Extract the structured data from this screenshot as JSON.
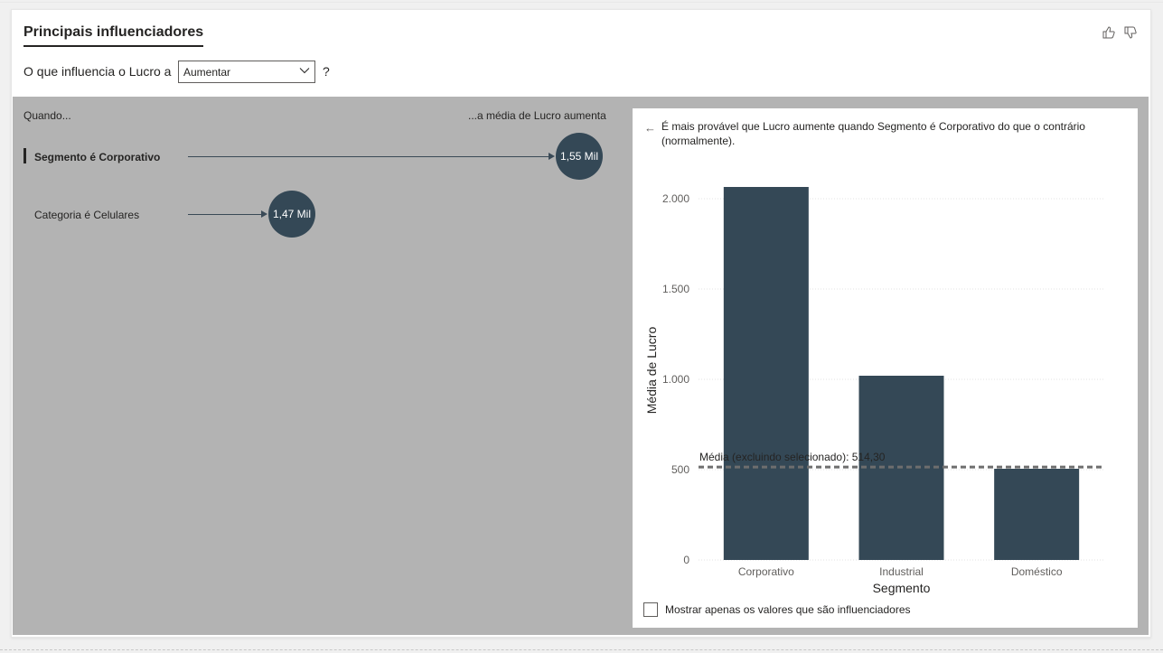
{
  "header": {
    "title": "Principais influenciadores"
  },
  "question": {
    "prefix": "O que influencia o Lucro a",
    "selected": "Aumentar",
    "suffix": "?"
  },
  "influencers": {
    "col_left": "Quando...",
    "col_right": "...a média de Lucro aumenta",
    "items": [
      {
        "label": "Segmento é Corporativo",
        "value": "1,55 Mil",
        "selected": true
      },
      {
        "label": "Categoria é Celulares",
        "value": "1,47 Mil",
        "selected": false
      }
    ]
  },
  "detail": {
    "description": "É mais provável que Lucro aumente quando Segmento é Corporativo do que o contrário (normalmente).",
    "checkbox_label": "Mostrar apenas os valores que são influenciadores"
  },
  "chart_data": {
    "type": "bar",
    "categories": [
      "Corporativo",
      "Industrial",
      "Doméstico"
    ],
    "values": [
      2065,
      1020,
      505
    ],
    "ylabel": "Média de Lucro",
    "xlabel": "Segmento",
    "ylim": [
      0,
      2200
    ],
    "yticks": [
      0,
      500,
      1000,
      1500,
      2000
    ],
    "ytick_labels": [
      "0",
      "500",
      "1.000",
      "1.500",
      "2.000"
    ],
    "reference_line": {
      "value": 514.3,
      "label": "Média (excluindo selecionado): 514,30"
    },
    "bar_color": "#344856",
    "grid": true
  },
  "colors": {
    "accent": "#344856",
    "panel_bg": "#b3b3b3"
  }
}
